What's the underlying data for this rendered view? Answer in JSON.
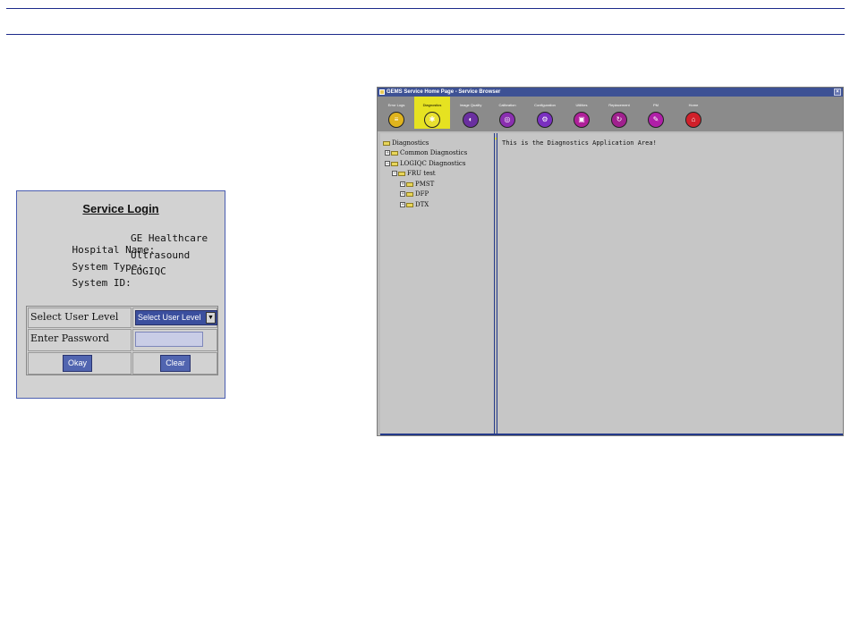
{
  "login": {
    "title": "Service Login",
    "hospital_label": "Hospital Name:",
    "hospital_value": "GE Healthcare",
    "system_type_label": "System Type:",
    "system_type_value": "Ultrasound",
    "system_id_label": "System ID:",
    "system_id_value": "LOGIQC",
    "user_level_label": "Select User Level",
    "user_level_selected": "Select User Level",
    "password_label": "Enter Password",
    "password_value": "",
    "okay_label": "Okay",
    "clear_label": "Clear"
  },
  "browser": {
    "title": "GEMS Service Home Page - Service Browser",
    "close_glyph": "×",
    "tools": [
      {
        "label": "Error Logs",
        "color": "#e0b41e",
        "icon": "list-icon",
        "glyph": "≡"
      },
      {
        "label": "Diagnostics",
        "color": "#e8e030",
        "icon": "diagnostics-icon",
        "glyph": "✱"
      },
      {
        "label": "Image Quality",
        "color": "#6a2fa0",
        "icon": "image-quality-icon",
        "glyph": "◐"
      },
      {
        "label": "Calibration",
        "color": "#8a2fb0",
        "icon": "calibration-icon",
        "glyph": "◎"
      },
      {
        "label": "Configuration",
        "color": "#7a30c0",
        "icon": "configuration-icon",
        "glyph": "⚙"
      },
      {
        "label": "Utilities",
        "color": "#b0209a",
        "icon": "utilities-icon",
        "glyph": "▣"
      },
      {
        "label": "Replacement",
        "color": "#a0208e",
        "icon": "replacement-icon",
        "glyph": "↻"
      },
      {
        "label": "PM",
        "color": "#b01fa8",
        "icon": "pm-icon",
        "glyph": "✎"
      },
      {
        "label": "Home",
        "color": "#d0202a",
        "icon": "home-icon",
        "glyph": "⌂"
      }
    ],
    "tree": [
      {
        "label": "Diagnostics",
        "expander": ""
      },
      {
        "label": "Common Diagnostics",
        "expander": "+"
      },
      {
        "label": "LOGIQC Diagnostics",
        "expander": "−"
      },
      {
        "label": "FRU test",
        "expander": "−"
      },
      {
        "label": "PMST",
        "expander": "+"
      },
      {
        "label": "DFP",
        "expander": "+"
      },
      {
        "label": "DTX",
        "expander": "+"
      }
    ],
    "content_message": "This is the Diagnostics Application Area!"
  }
}
